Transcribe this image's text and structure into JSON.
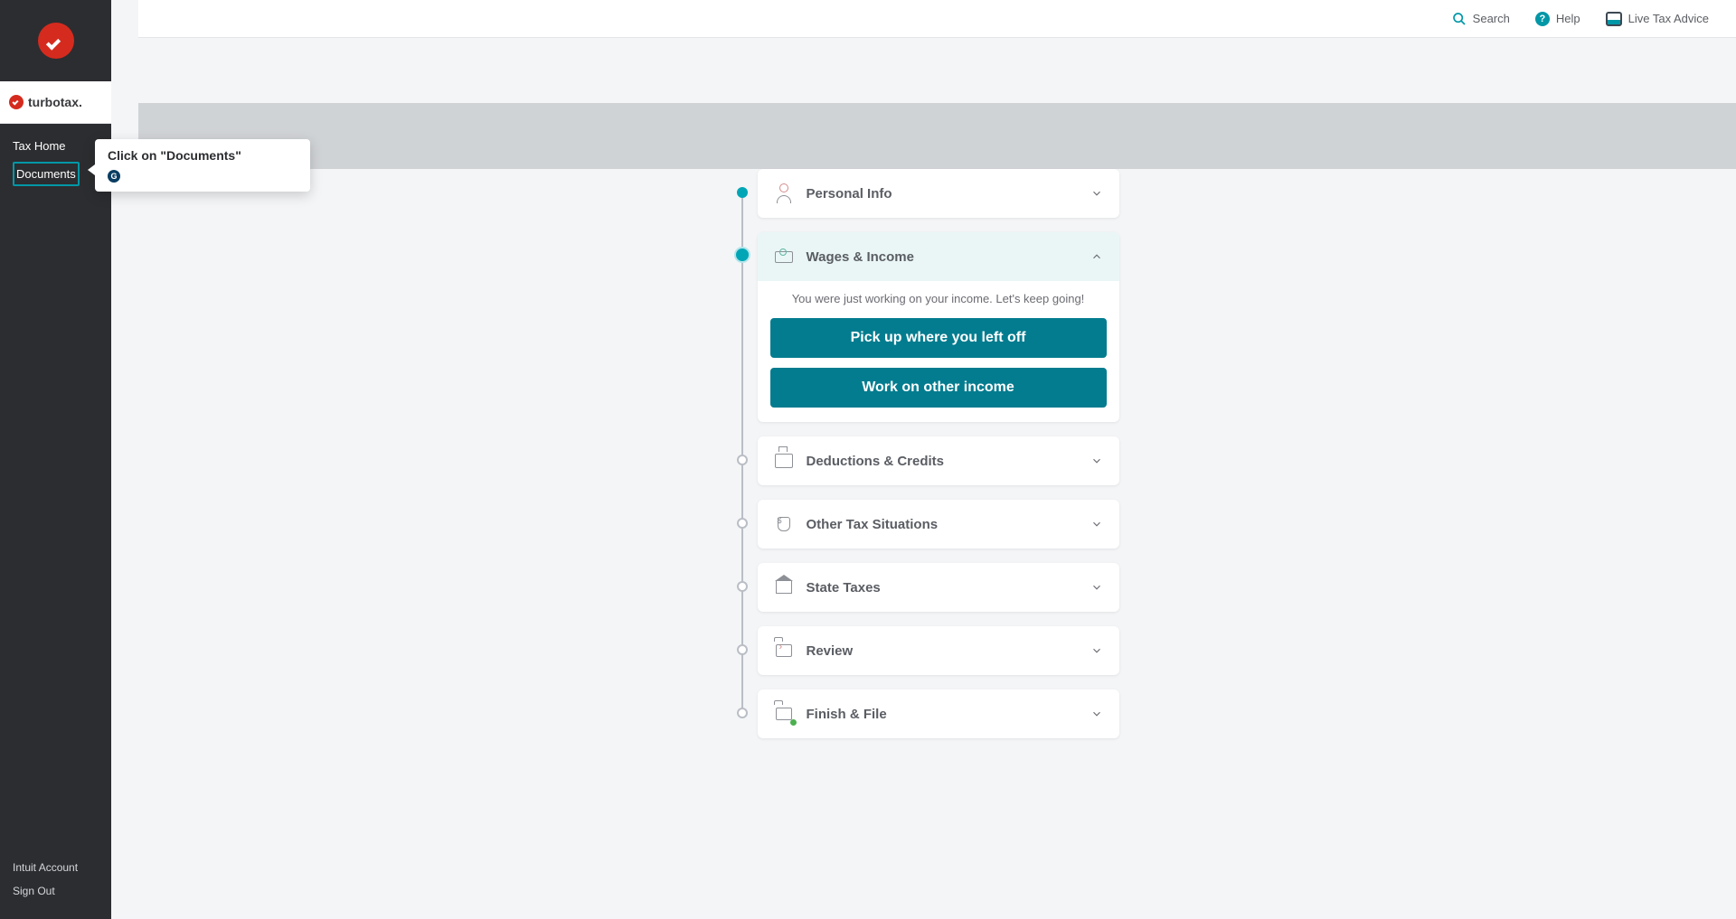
{
  "brand": {
    "name": "turbotax."
  },
  "topbar": {
    "search": "Search",
    "help": "Help",
    "live": "Live Tax Advice"
  },
  "sidebar": {
    "nav": {
      "tax_home": "Tax Home",
      "documents": "Documents"
    },
    "bottom": {
      "account": "Intuit Account",
      "signout": "Sign Out"
    }
  },
  "tooltip": {
    "title": "Click on \"Documents\"",
    "badge": "G"
  },
  "timeline": {
    "personal_info": "Personal Info",
    "wages_income": {
      "title": "Wages & Income",
      "message": "You were just working on your income. Let's keep going!",
      "btn_resume": "Pick up where you left off",
      "btn_other": "Work on other income"
    },
    "deductions": "Deductions & Credits",
    "other_situations": "Other Tax Situations",
    "state_taxes": "State Taxes",
    "review": "Review",
    "finish_file": "Finish & File"
  }
}
